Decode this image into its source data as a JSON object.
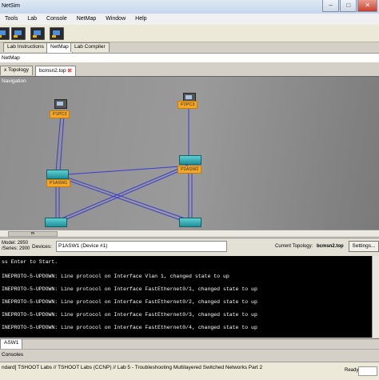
{
  "window": {
    "title": "NetSim"
  },
  "menu": [
    "Tools",
    "Lab",
    "Console",
    "NetMap",
    "Window",
    "Help"
  ],
  "tabs_main": [
    "Lab Instructions",
    "NetMap",
    "Lab Compiler"
  ],
  "active_tab": "NetMap",
  "netmap_header": "NetMap",
  "tabs_topology": [
    "x Topology",
    "bcmsn2.top"
  ],
  "canvas": {
    "nav_label": "Navigation",
    "devices": [
      "P1PC3",
      "P2PC3",
      "P1ASW1",
      "P2ASW2"
    ]
  },
  "scroll_thumb": "m",
  "info": {
    "model_label": "Model:",
    "model_value": "2950",
    "series_label": "/Series:",
    "series_value": "2900",
    "devices_label": "Devices:",
    "device_selected": "P1ASW1  (Device #1)",
    "topology_label": "Current Topology:",
    "topology_value": "bcmsn2.top",
    "settings_label": "Settings..."
  },
  "console_lines": [
    "ss Enter to Start.",
    "",
    "INEPROTO-5-UPDOWN: Line protocol on Interface Vlan 1, changed state to up",
    "",
    "INEPROTO-5-UPDOWN: Line protocol on Interface FastEthernet0/1, changed state to up",
    "",
    "INEPROTO-5-UPDOWN: Line protocol on Interface FastEthernet0/2, changed state to up",
    "",
    "INEPROTO-5-UPDOWN: Line protocol on Interface FastEthernet0/3, changed state to up",
    "",
    "INEPROTO-5-UPDOWN: Line protocol on Interface FastEthernet0/4, changed state to up"
  ],
  "console_tab": "ASW1",
  "consoles_label": "Consoles",
  "status": {
    "text": "ndard] TSHOOT Labs // TSHOOT Labs (CCNP) // Lab 5 - Troubleshooting Multilayered Switched Networks Part 2",
    "ready": "Ready"
  }
}
